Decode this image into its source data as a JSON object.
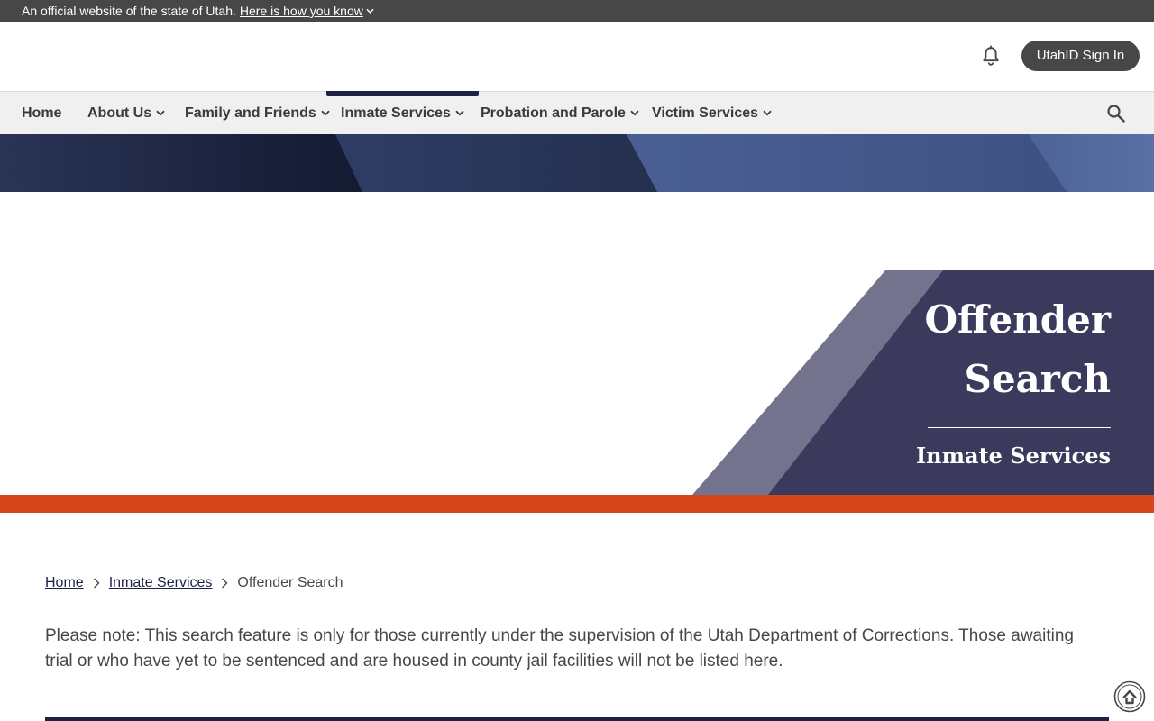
{
  "gov_banner": {
    "text": "An official website of the state of Utah.",
    "link": "Here is how you know"
  },
  "header": {
    "signin_label": "UtahID Sign In",
    "icons": {
      "notifications": "bell-icon"
    }
  },
  "nav": {
    "items": [
      {
        "label": "Home",
        "has_menu": false
      },
      {
        "label": "About Us",
        "has_menu": true
      },
      {
        "label": "Family and Friends",
        "has_menu": true
      },
      {
        "label": "Inmate Services",
        "has_menu": true,
        "active": true
      },
      {
        "label": "Probation and Parole",
        "has_menu": true
      },
      {
        "label": "Victim Services",
        "has_menu": true
      }
    ],
    "icons": {
      "search": "search-icon"
    }
  },
  "hero": {
    "title_line1": "Offender",
    "title_line2": "Search",
    "subtitle": "Inmate Services"
  },
  "breadcrumb": {
    "items": [
      "Home",
      "Inmate Services"
    ],
    "current": "Offender Search"
  },
  "content": {
    "note": "Please note: This search feature is only for those currently under the supervision of the Utah Department of Corrections. Those awaiting trial or who have yet to be sentenced and are housed in county jail facilities will not be listed here."
  },
  "colors": {
    "banner_bg": "#474747",
    "nav_bg": "#f0f0f0",
    "accent_navy": "#1e2244",
    "hero_panel": "#3b3a5c",
    "hero_stripe": "#74738e",
    "accent_orange": "#d4451b"
  }
}
